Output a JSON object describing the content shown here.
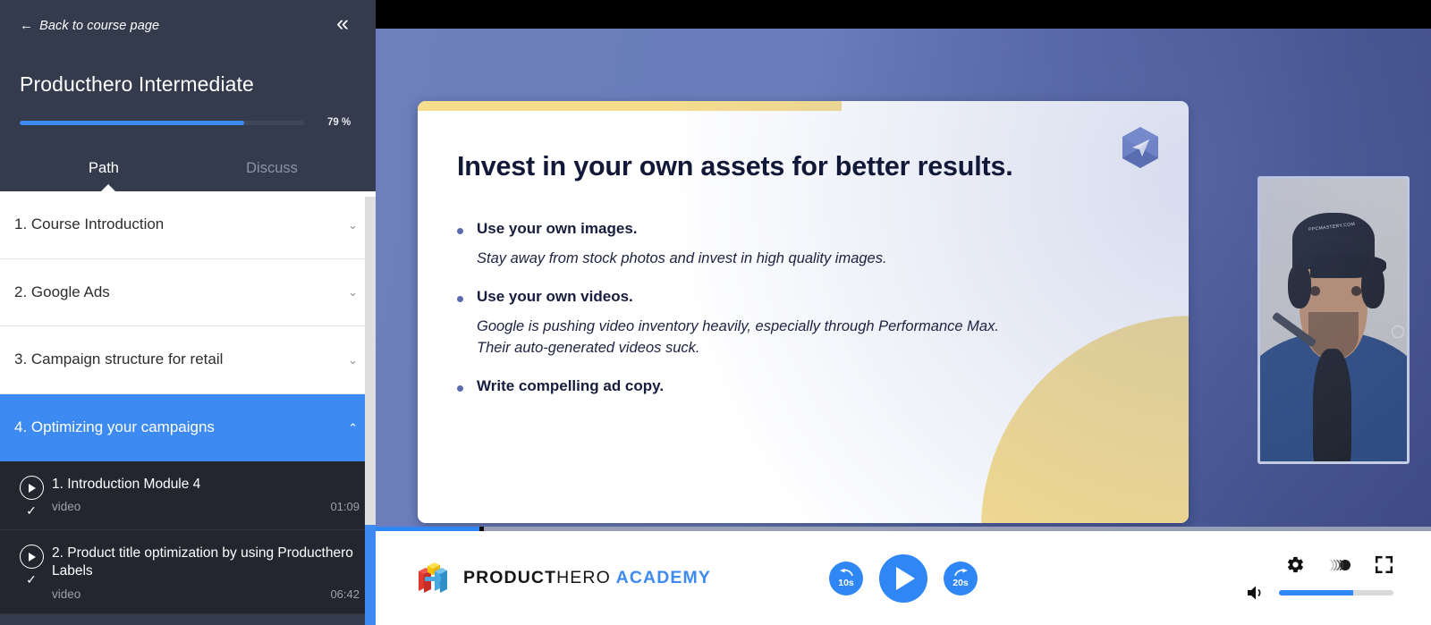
{
  "sidebar": {
    "back_label": "Back to course page",
    "back_arrow": "←",
    "collapse_icon": "«",
    "course_title": "Producthero Intermediate",
    "progress_percent": 79,
    "progress_label": "79 %",
    "tabs": [
      {
        "label": "Path",
        "active": true
      },
      {
        "label": "Discuss",
        "active": false
      }
    ],
    "modules": [
      {
        "label": "1. Course Introduction",
        "chevron": "⌄",
        "active": false
      },
      {
        "label": "2. Google Ads",
        "chevron": "⌄",
        "active": false
      },
      {
        "label": "3. Campaign structure for retail",
        "chevron": "⌄",
        "active": false
      },
      {
        "label": "4. Optimizing your campaigns",
        "chevron": "⌃",
        "active": true
      }
    ],
    "lessons": [
      {
        "title": "1. Introduction Module 4",
        "type": "video",
        "duration": "01:09",
        "completed": "✓"
      },
      {
        "title": "2. Product title optimization by using Producthero Labels",
        "type": "video",
        "duration": "06:42",
        "completed": "✓"
      }
    ]
  },
  "slide": {
    "heading": "Invest in your own assets for better results.",
    "bullets": [
      {
        "text": "Use your own images.",
        "sub": "Stay away from stock photos and invest in high quality images."
      },
      {
        "text": "Use your own videos.",
        "sub": "Google is pushing video inventory heavily, especially through Performance Max. Their auto-generated videos suck."
      },
      {
        "text": "Write compelling ad copy.",
        "sub": ""
      }
    ],
    "badge_icon": "paper-plane-hex-icon",
    "accent_color": "#f7dd8d",
    "heading_color": "#111838"
  },
  "webcam": {
    "cap_text": "PPCMASTERY.COM"
  },
  "player": {
    "progress_percent": 10,
    "logo": {
      "part1": "PRODUCT",
      "part2": "HERO",
      "part3": "ACADEMY"
    },
    "rewind_label": "10s",
    "forward_label": "20s",
    "play_icon": "play-icon",
    "settings_icon": "gear-icon",
    "quality_icon": "cast-icon",
    "fullscreen_icon": "fullscreen-icon",
    "volume_icon": "volume-icon",
    "volume_percent": 65,
    "accent_color": "#2f86f5"
  }
}
